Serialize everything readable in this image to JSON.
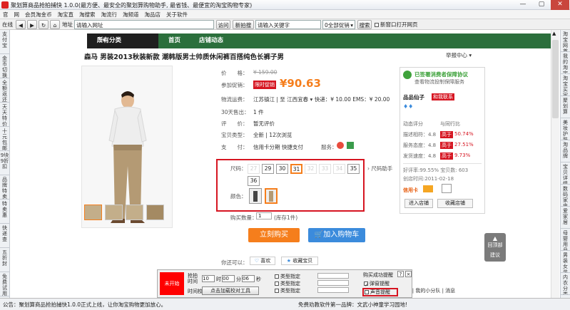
{
  "window": {
    "title": "聚划算商品抢拍捕快 1.0.0(最方便、最安全的聚划算购物助手, 最省钱、最便宜的淘宝购物专家)",
    "controls": [
      "—",
      "▢",
      "✕"
    ]
  },
  "menu": [
    "官",
    "网",
    "会员淘金币",
    "淘宝直",
    "淘搜索",
    "淘流行",
    "淘频道",
    "淘品店",
    "关于软件"
  ],
  "toolbar": {
    "label_online": "在线",
    "label_address": "地址",
    "address_value": "请输入网址",
    "visit": "访问",
    "new_search": "新拍搜索",
    "search_value": "请输入关键字",
    "promo_select": "0全部促销",
    "search_btn": "搜索",
    "new_window": "新窗口打开网页"
  },
  "left_tabs": [
    "支付宝",
    "金币切换",
    "全额返还",
    "天天特价",
    "十元包邮",
    "9块9折扣",
    "品牌特卖",
    "特卖惠",
    "快递查",
    "五折封",
    "免费试用"
  ],
  "right_tabs": [
    "淘宝网首页",
    "我的淘宝",
    "淘宝买家",
    "聚划算",
    "美妆护肤",
    "淘品牌",
    "宝贝详情",
    "数码家电",
    "爱家居",
    "母婴用品",
    "男装女装",
    "内衣分类"
  ],
  "nav": {
    "category": "所有分类",
    "home": "首页",
    "shop": "店铺动态"
  },
  "product": {
    "title": "森马 男装2013秋装新款 潮韩版男士帅质休闲裤百搭纯色长裤子男",
    "report": "举报中心",
    "price_label": "价　　格：",
    "price": "¥ 159.00",
    "promo_label": "参加促销：",
    "promo_tag": "限时促销",
    "promo_price": "¥90.63",
    "shipping_label": "物流运费：",
    "shipping_value": "江苏镇江 | 至 江西宜春 ▾ 快递：¥ 10.00  EMS：¥ 20.00",
    "sold_label": "30天售出：",
    "sold_value": "1 件",
    "review_label": "评　　价：",
    "review_value": "暂无评价",
    "condition_label": "宝贝类型：",
    "condition_value": "全新 | 12次浏览",
    "pay_label": "支　　付：",
    "pay_value": "信用卡分期  快捷支付",
    "service_label": "服务：",
    "size_label": "尺码：",
    "sizes": [
      {
        "v": "27",
        "off": true
      },
      {
        "v": "29",
        "off": false
      },
      {
        "v": "30",
        "off": false
      },
      {
        "v": "31",
        "off": false
      },
      {
        "v": "32",
        "off": true
      },
      {
        "v": "33",
        "off": true
      },
      {
        "v": "34",
        "off": true
      },
      {
        "v": "35",
        "off": false
      },
      {
        "v": "36",
        "off": false
      }
    ],
    "size_help": "尺码助手",
    "color_label": "颜色：",
    "qty_label": "购买数量：",
    "qty_value": "1",
    "stock": "(库存1件)",
    "buy_now": "立刻购买",
    "add_cart": "加入购物车",
    "also_label": "你还可以：",
    "like": "喜欢",
    "favorite": "收藏宝贝"
  },
  "seller": {
    "guarantee": "已签署消费者保障协议",
    "guarantee_sub": "查看物流投制保障服务",
    "shop_name": "品品仙子",
    "contact": "和我联系",
    "rating_head": "动态评分",
    "compare_head": "与同行比",
    "ratings": [
      {
        "name": "描述相符：4.8",
        "tag": "高于",
        "pct": "50.74%"
      },
      {
        "name": "服务态度：4.8",
        "tag": "高于",
        "pct": "27.51%"
      },
      {
        "name": "发货速度：4.8",
        "tag": "高于",
        "pct": "9.73%"
      }
    ],
    "good_rate": "好评率:99.55%  宝贝数: 603",
    "created": "创店时间:2011-02-18",
    "credit": "信用卡",
    "enter_shop": "进入店铺",
    "fav_shop": "收藏店铺"
  },
  "float": {
    "top": "回顶部",
    "suggest": "建议"
  },
  "bottom_panel": {
    "grab_label": "未开始",
    "time_label": "抢拍时间",
    "hour": "10",
    "minute": "00",
    "second": "06",
    "hour_u": "时",
    "minute_u": "分",
    "second_u": "秒",
    "calib_label": "时间校对",
    "calib_btn": "点击加载校对工具",
    "types": [
      "类型指定",
      "类型指定",
      "类型指定"
    ],
    "success_label": "购买成功提醒",
    "popup": "弹窗提醒",
    "sound": "声音提醒",
    "help": "?",
    "close": "×"
  },
  "page_links": "推荐 | 我的U站 | 我的钱包 | 淘足迹 | 我的小分队 | 消息",
  "status": {
    "left": "公告：聚划算商品抢拍捕快1.0.0正式上线，让你淘宝购物更加放心。",
    "right": "免费劝教软件第一品牌：文武小神童学习园地!"
  },
  "colors": {
    "nav_green": "#2b6f3c",
    "buy_orange": "#f57e1c",
    "cart_blue": "#3b8bdc",
    "highlight_red": "#d61521"
  }
}
